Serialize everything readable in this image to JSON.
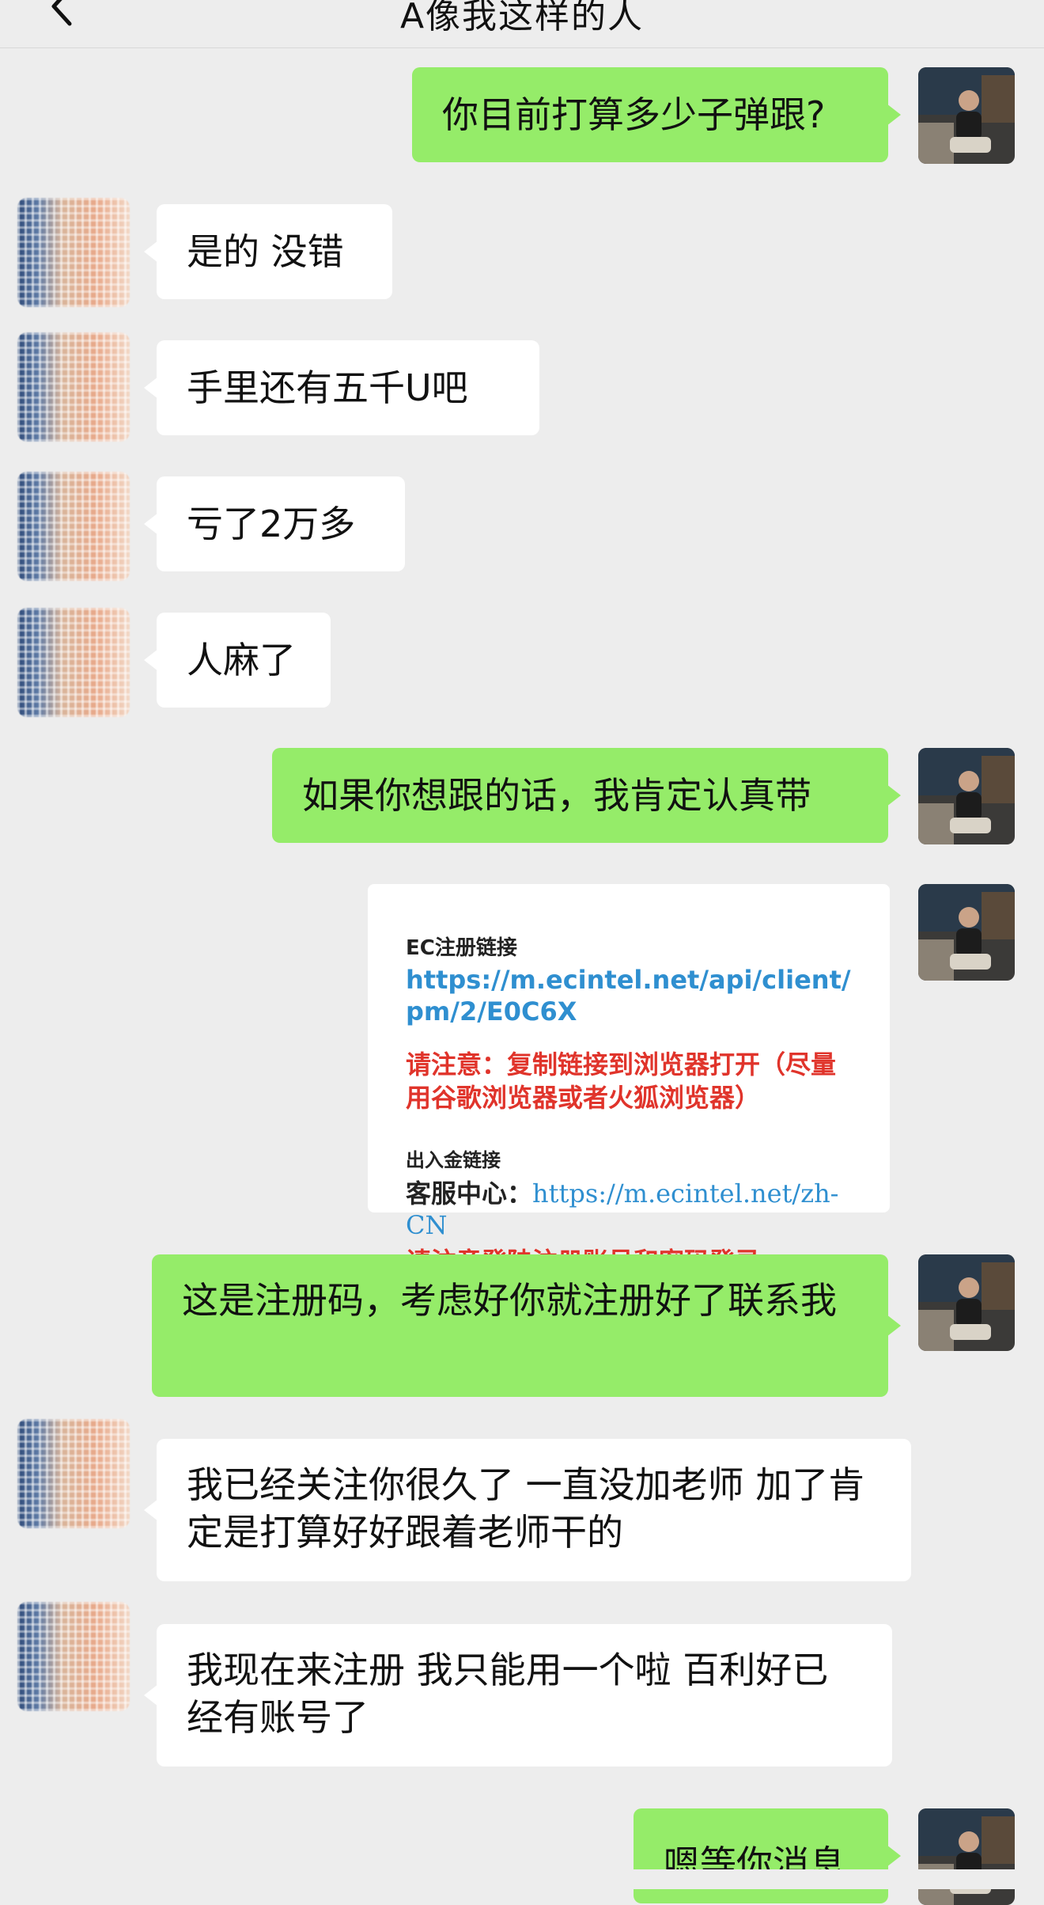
{
  "header": {
    "title": "A像我这样的人"
  },
  "colors": {
    "self_bubble": "#95ec69",
    "other_bubble": "#ffffff",
    "background": "#ededed",
    "link": "#2f8fd0",
    "warning": "#e0342b"
  },
  "messages": [
    {
      "from": "self",
      "text": "你目前打算多少子弹跟?"
    },
    {
      "from": "other",
      "text": "是的 没错"
    },
    {
      "from": "other",
      "text": "手里还有五千U吧"
    },
    {
      "from": "other",
      "text": "亏了2万多"
    },
    {
      "from": "other",
      "text": "人麻了"
    },
    {
      "from": "self",
      "text": "如果你想跟的话，我肯定认真带"
    },
    {
      "from": "self",
      "text": "这是注册码，考虑好你就注册好了联系我"
    },
    {
      "from": "other",
      "text": "我已经关注你很久了 一直没加老师 加了肯定是打算好好跟着老师干的"
    },
    {
      "from": "other",
      "text": "我现在来注册 我只能用一个啦 百利好已经有账号了"
    },
    {
      "from": "self",
      "text": "嗯等你消息"
    }
  ],
  "card": {
    "heading": "EC注册链接",
    "link": "https://m.ecintel.net/api/client/pm/2/E0C6X",
    "warning1": "请注意：复制链接到浏览器打开（尽量用谷歌浏览器或者火狐浏览器）",
    "subheading": "出入金链接",
    "service_label": "客服中心：",
    "service_link": "https://m.ecintel.net/zh-CN",
    "warning2": "请注意登陆注册账号和密码登录"
  }
}
